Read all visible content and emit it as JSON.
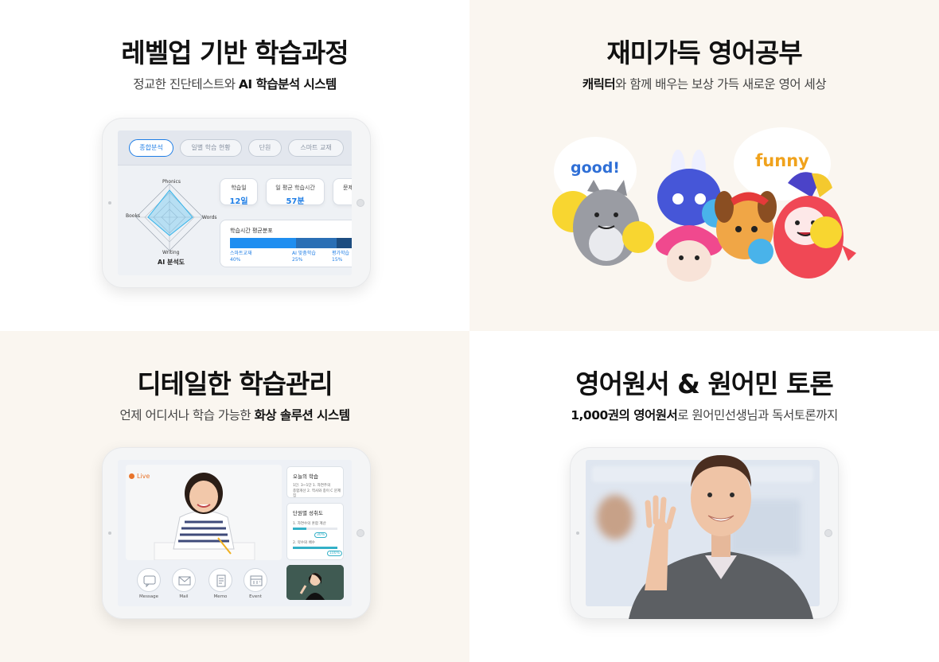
{
  "sections": [
    {
      "title": "레벨업 기반 학습과정",
      "subtitle_plain": "정교한 진단테스트와 ",
      "subtitle_bold": "AI 학습분석 시스템",
      "screen": {
        "tabs": [
          "종합분석",
          "일별 학습 현황",
          "단원",
          "스마트 교재"
        ],
        "radar_labels": {
          "top": "Phonics",
          "left": "Books",
          "right": "Words",
          "bottom": "Writing"
        },
        "radar_caption": "AI 분석도",
        "stats": [
          {
            "label": "학습일",
            "value": "12일"
          },
          {
            "label": "일 평균 학습시간",
            "value": "57분"
          },
          {
            "label": "문제",
            "value": ""
          }
        ],
        "distribution": {
          "title": "학습시간 평균분포",
          "items": [
            {
              "label": "스마트교재",
              "percent": "40%",
              "fraction": 0.52,
              "color": "#1f8ef0"
            },
            {
              "label": "AI 맞춤학습",
              "percent": "25%",
              "fraction": 0.32,
              "color": "#2a6fb5"
            },
            {
              "label": "평가학습",
              "percent": "15%",
              "fraction": 0.16,
              "color": "#1d4d80"
            }
          ]
        }
      }
    },
    {
      "title": "재미가득 영어공부",
      "subtitle_bold": "캐릭터",
      "subtitle_plain": "와 함께 배우는 보상 가득 새로운 영어 세상",
      "bubbles": [
        "good!",
        "funny"
      ]
    },
    {
      "title": "디테일한 학습관리",
      "subtitle_plain": "언제 어디서나 학습 가능한 ",
      "subtitle_bold": "화상 솔루션 시스템",
      "screen": {
        "live_label": "Live",
        "today_panel": {
          "title": "오늘의 학습",
          "lines": [
            "1단. 3~1단 1. 자연주의",
            "종합개선 2. 역사와 종이 C 문제집"
          ]
        },
        "progress_panel": {
          "title": "단원별 성취도",
          "items": [
            {
              "label": "1. 자연수의 혼합 계산",
              "percent": "30%",
              "fraction": 0.3
            },
            {
              "label": "2. 약수와 배수",
              "percent": "100%",
              "fraction": 1.0
            }
          ]
        },
        "buttons": [
          "Message",
          "Mail",
          "Memo",
          "Event"
        ]
      }
    },
    {
      "title": "영어원서 & 원어민 토론",
      "subtitle_bold": "1,000권의 영어원서",
      "subtitle_plain": "로 원어민선생님과 독서토론까지"
    }
  ],
  "colors": {
    "accent_blue": "#1f7ee6",
    "live_orange": "#e8742b",
    "cream_bg": "#faf6f0"
  }
}
